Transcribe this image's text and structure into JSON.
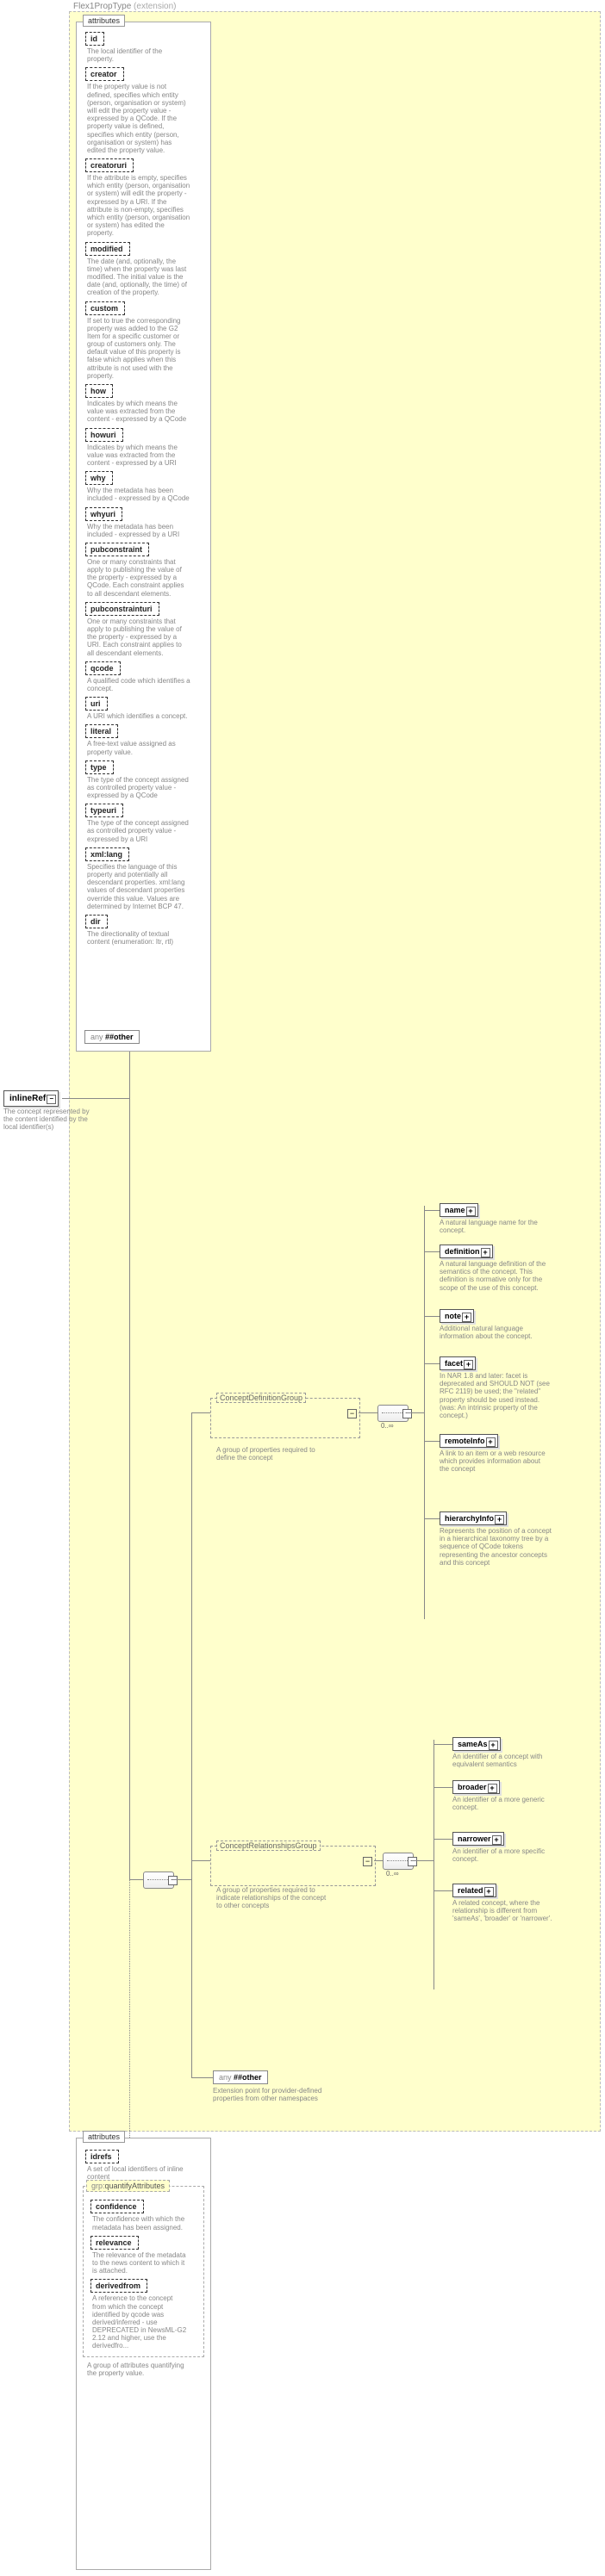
{
  "header": {
    "title": "Flex1PropType",
    "note": "(extension)"
  },
  "root": {
    "name": "inlineRef",
    "desc": "The concept represented by the content identified by the local identifier(s)",
    "exp": "−"
  },
  "attrbox_label": "attributes",
  "attrs": [
    {
      "n": "id",
      "d": "The local identifier of the property."
    },
    {
      "n": "creator",
      "d": "If the property value is not defined, specifies which entity (person, organisation or system) will edit the property value - expressed by a QCode. If the property value is defined, specifies which entity (person, organisation or system) has edited the property value."
    },
    {
      "n": "creatoruri",
      "d": "If the attribute is empty, specifies which entity (person, organisation or system) will edit the property - expressed by a URI. If the attribute is non-empty, specifies which entity (person, organisation or system) has edited the property."
    },
    {
      "n": "modified",
      "d": "The date (and, optionally, the time) when the property was last modified. The initial value is the date (and, optionally, the time) of creation of the property."
    },
    {
      "n": "custom",
      "d": "If set to true the corresponding property was added to the G2 Item for a specific customer or group of customers only. The default value of this property is false which applies when this attribute is not used with the property."
    },
    {
      "n": "how",
      "d": "Indicates by which means the value was extracted from the content - expressed by a QCode"
    },
    {
      "n": "howuri",
      "d": "Indicates by which means the value was extracted from the content - expressed by a URI"
    },
    {
      "n": "why",
      "d": "Why the metadata has been included - expressed by a QCode"
    },
    {
      "n": "whyuri",
      "d": "Why the metadata has been included - expressed by a URI"
    },
    {
      "n": "pubconstraint",
      "d": "One or many constraints that apply to publishing the value of the property - expressed by a QCode. Each constraint applies to all descendant elements."
    },
    {
      "n": "pubconstrainturi",
      "d": "One or many constraints that apply to publishing the value of the property - expressed by a URI. Each constraint applies to all descendant elements."
    },
    {
      "n": "qcode",
      "d": "A qualified code which identifies a concept."
    },
    {
      "n": "uri",
      "d": "A URI which identifies a concept."
    },
    {
      "n": "literal",
      "d": "A free-text value assigned as property value."
    },
    {
      "n": "type",
      "d": "The type of the concept assigned as controlled property value - expressed by a QCode"
    },
    {
      "n": "typeuri",
      "d": "The type of the concept assigned as controlled property value - expressed by a URI"
    },
    {
      "n": "xml:lang",
      "d": "Specifies the language of this property and potentially all descendant properties. xml:lang values of descendant properties override this value. Values are determined by Internet BCP 47."
    },
    {
      "n": "dir",
      "d": "The directionality of textual content (enumeration: ltr, rtl)"
    }
  ],
  "any_other": "##other",
  "groups": {
    "def": {
      "title": "ConceptDefinitionGroup",
      "desc": "A group of properties required to define the concept"
    },
    "rel": {
      "title": "ConceptRelationshipsGroup",
      "desc": "A group of properties required to indicate relationships of the concept to other concepts"
    }
  },
  "def_children": [
    {
      "n": "name",
      "d": "A natural language name for the concept."
    },
    {
      "n": "definition",
      "d": "A natural language definition of the semantics of the concept. This definition is normative only for the scope of the use of this concept."
    },
    {
      "n": "note",
      "d": "Additional natural language information about the concept."
    },
    {
      "n": "facet",
      "d": "In NAR 1.8 and later: facet is deprecated and SHOULD NOT (see RFC 2119) be used; the \"related\" property should be used instead. (was: An intrinsic property of the concept.)"
    },
    {
      "n": "remoteInfo",
      "d": "A link to an item or a web resource which provides information about the concept"
    },
    {
      "n": "hierarchyInfo",
      "d": "Represents the position of a concept in a hierarchical taxonomy tree by a sequence of QCode tokens representing the ancestor concepts and this concept"
    }
  ],
  "rel_children": [
    {
      "n": "sameAs",
      "d": "An identifier of a concept with equivalent semantics"
    },
    {
      "n": "broader",
      "d": "An identifier of a more generic concept."
    },
    {
      "n": "narrower",
      "d": "An identifier of a more specific concept."
    },
    {
      "n": "related",
      "d": "A related concept, where the relationship is different from 'sameAs', 'broader' or 'narrower'."
    }
  ],
  "ext_desc": "Extension point for provider-defined properties from other namespaces",
  "attrs2": {
    "label": "attributes",
    "idrefs": {
      "n": "idrefs",
      "d": "A set of local identifiers of inline content"
    },
    "grplabel": "quantifyAttributes",
    "grpprefix": "grp:",
    "items": [
      {
        "n": "confidence",
        "d": "The confidence with which the metadata has been assigned."
      },
      {
        "n": "relevance",
        "d": "The relevance of the metadata to the news content to which it is attached."
      },
      {
        "n": "derivedfrom",
        "d": "A reference to the concept from which the concept identified by qcode was derived/inferred - use DEPRECATED in NewsML-G2 2.12 and higher, use the derivedfro..."
      }
    ],
    "grpdesc": "A group of attributes quantifying the property value."
  },
  "seq_card": "0..∞",
  "any_prefix": "any "
}
